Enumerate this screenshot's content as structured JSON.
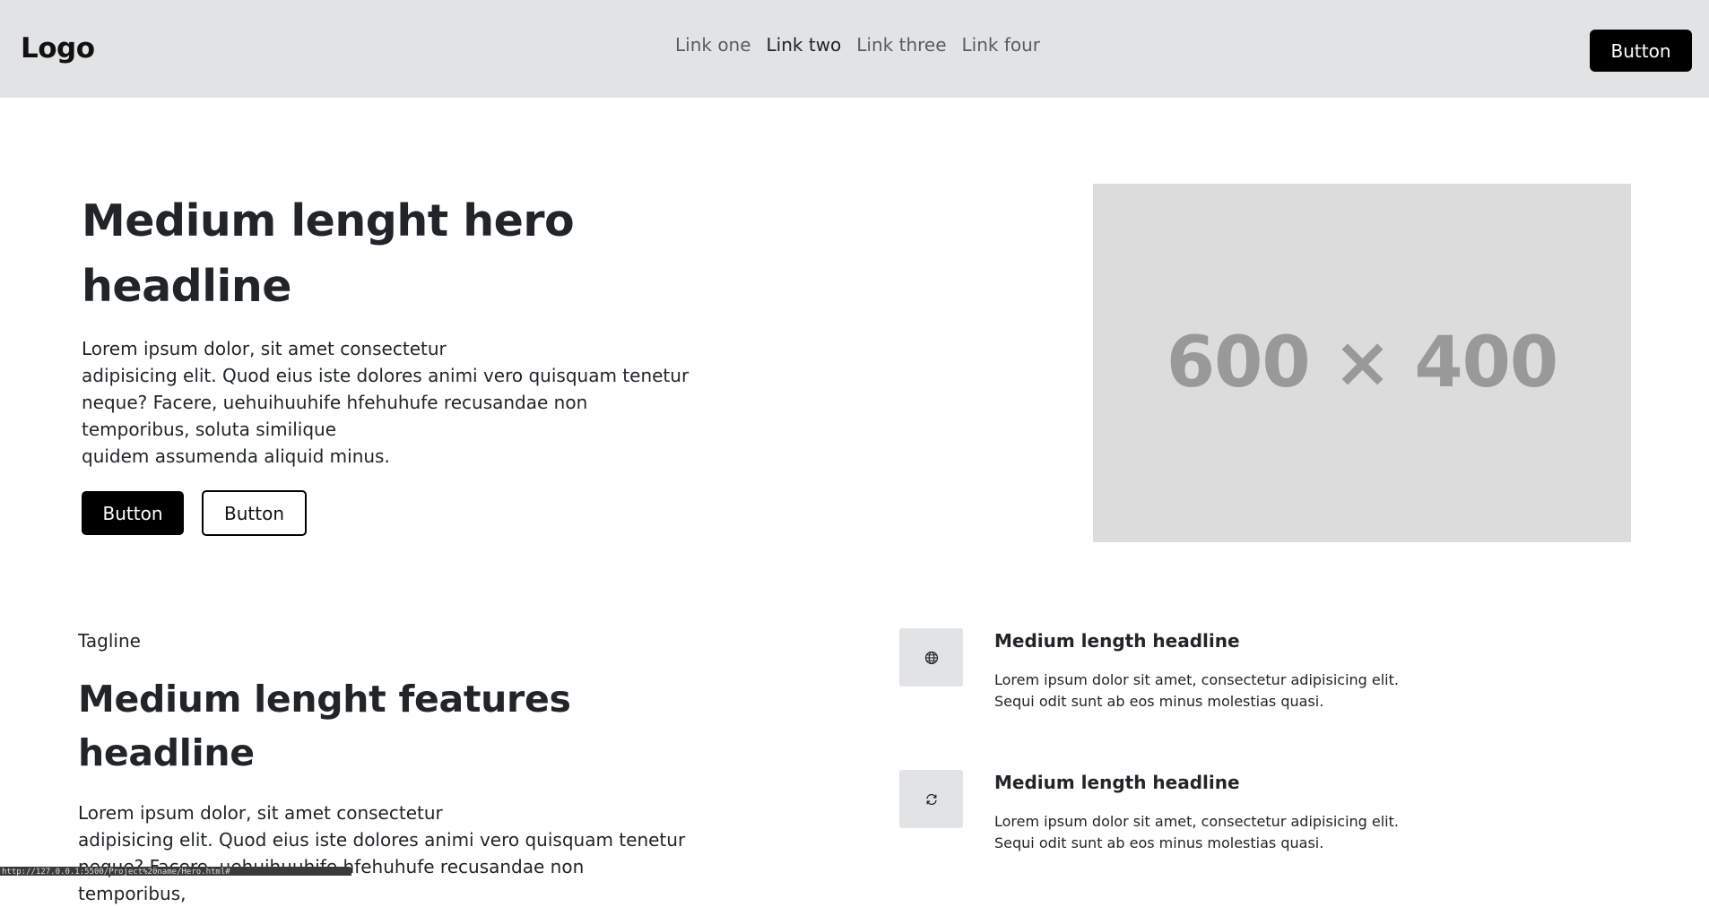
{
  "navbar": {
    "logo": "Logo",
    "links": [
      {
        "label": "Link one",
        "active": false
      },
      {
        "label": "Link two",
        "active": true
      },
      {
        "label": "Link three",
        "active": false
      },
      {
        "label": "Link four",
        "active": false
      }
    ],
    "button_label": "Button"
  },
  "hero": {
    "headline": "Medium lenght hero headline",
    "paragraph_lines": [
      "Lorem ipsum dolor, sit amet consectetur",
      "adipisicing elit. Quod eius iste dolores animi vero quisquam tenetur",
      "neque? Facere, uehuihuuhife hfehuhufe recusandae non temporibus, soluta similique",
      "quidem assumenda aliquid minus."
    ],
    "primary_button": "Button",
    "secondary_button": "Button",
    "image_placeholder": "600 × 400"
  },
  "features": {
    "tagline": "Tagline",
    "headline": "Medium lenght features headline",
    "paragraph_lines": [
      "Lorem ipsum dolor, sit amet consectetur",
      "adipisicing elit. Quod eius iste dolores animi vero quisquam tenetur",
      "neque? Facere, uehuihuuhife hfehuhufe recusandae non temporibus,"
    ],
    "items": [
      {
        "icon": "globe-icon",
        "headline": "Medium length headline",
        "desc_lines": [
          "Lorem ipsum dolor sit amet, consectetur adipisicing elit.",
          "Sequi odit sunt ab eos minus molestias quasi."
        ]
      },
      {
        "icon": "refresh-icon",
        "headline": "Medium length headline",
        "desc_lines": [
          "Lorem ipsum dolor sit amet, consectetur adipisicing elit.",
          "Sequi odit sunt ab eos minus molestias quasi."
        ]
      }
    ]
  },
  "status_bar": {
    "url": "http://127.0.0.1:5500/Project%20name/Hero.html#"
  },
  "colors": {
    "navbar_bg": "#e2e3e5",
    "primary": "#000000",
    "placeholder_bg": "#dcdcdc",
    "placeholder_text": "#999999"
  }
}
